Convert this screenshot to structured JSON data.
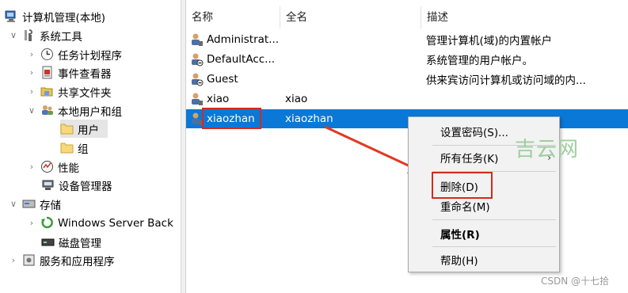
{
  "tree": {
    "root": "计算机管理(本地)",
    "system_tools": "系统工具",
    "task_scheduler": "任务计划程序",
    "event_viewer": "事件查看器",
    "shared_folders": "共享文件夹",
    "local_users_groups": "本地用户和组",
    "users": "用户",
    "groups": "组",
    "performance": "性能",
    "device_manager": "设备管理器",
    "storage": "存储",
    "windows_server_backup": "Windows Server Back",
    "disk_management": "磁盘管理",
    "services_apps": "服务和应用程序"
  },
  "list": {
    "columns": [
      "名称",
      "全名",
      "描述"
    ],
    "rows": [
      {
        "name": "Administrat...",
        "fullname": "",
        "desc": "管理计算机(域)的内置帐户"
      },
      {
        "name": "DefaultAcc...",
        "fullname": "",
        "desc": "系统管理的用户帐户。"
      },
      {
        "name": "Guest",
        "fullname": "",
        "desc": "供来宾访问计算机或访问域的内..."
      },
      {
        "name": "xiao",
        "fullname": "xiao",
        "desc": ""
      },
      {
        "name": "xiaozhan",
        "fullname": "xiaozhan",
        "desc": ""
      }
    ]
  },
  "context_menu": {
    "set_password": "设置密码(S)...",
    "all_tasks": "所有任务(K)",
    "delete": "删除(D)",
    "rename": "重命名(M)",
    "properties": "属性(R)",
    "help": "帮助(H)"
  },
  "watermark": "吉云网",
  "credit": "CSDN @十七拾",
  "colors": {
    "selection": "#0a78d7",
    "highlight": "#d42a20",
    "arrow": "#e03a22"
  }
}
